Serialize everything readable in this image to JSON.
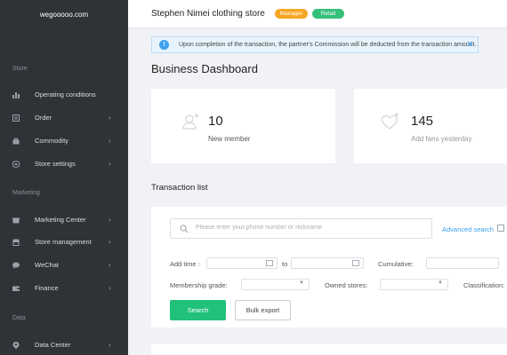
{
  "sidebar": {
    "logo": "wegooooo.com",
    "sections": {
      "store": "Store",
      "marketing": "Marketing",
      "data": "Data"
    },
    "items": [
      {
        "label": "Operating conditions",
        "icon": "bar-chart-icon",
        "has_chevron": false
      },
      {
        "label": "Order",
        "icon": "order-icon",
        "has_chevron": true
      },
      {
        "label": "Commodity",
        "icon": "bag-icon",
        "has_chevron": true
      },
      {
        "label": "Store settings",
        "icon": "gear-icon",
        "has_chevron": true
      },
      {
        "label": "Marketing Center",
        "icon": "gift-icon",
        "has_chevron": true
      },
      {
        "label": "Store management",
        "icon": "shop-icon",
        "has_chevron": true
      },
      {
        "label": "WeChat",
        "icon": "chat-icon",
        "has_chevron": true
      },
      {
        "label": "Finance",
        "icon": "wallet-icon",
        "has_chevron": true
      },
      {
        "label": "Data Center",
        "icon": "pin-icon",
        "has_chevron": true
      }
    ]
  },
  "header": {
    "store_name": "Stephen Nimei clothing store",
    "badges": {
      "manager": "Manager",
      "retail": "Retail"
    }
  },
  "notice": {
    "text": "Upon completion of the transaction, the partner's Commission will be deducted from the transaction amount."
  },
  "dashboard": {
    "title": "Business Dashboard",
    "cards": [
      {
        "value": "10",
        "label": "New member"
      },
      {
        "value": "145",
        "label": "Add fans yesterday"
      }
    ]
  },
  "transactions": {
    "title": "Transaction list",
    "search_placeholder": "Please enter your phone number or nickname",
    "advanced_search": "Advanced search",
    "filters": {
      "add_time": "Add time :",
      "to": "to",
      "cumulative": "Cumulative:",
      "membership_grade": "Membership grade:",
      "owned_stores": "Owned stores:",
      "classification": "Classification:"
    },
    "buttons": {
      "search": "Search",
      "export": "Bulk export"
    }
  },
  "colors": {
    "sidebar_bg": "#2f3338",
    "accent_green": "#21c17a",
    "badge_manager": "#f5a623",
    "badge_retail": "#35c07a",
    "link_blue": "#3ea1ec"
  }
}
